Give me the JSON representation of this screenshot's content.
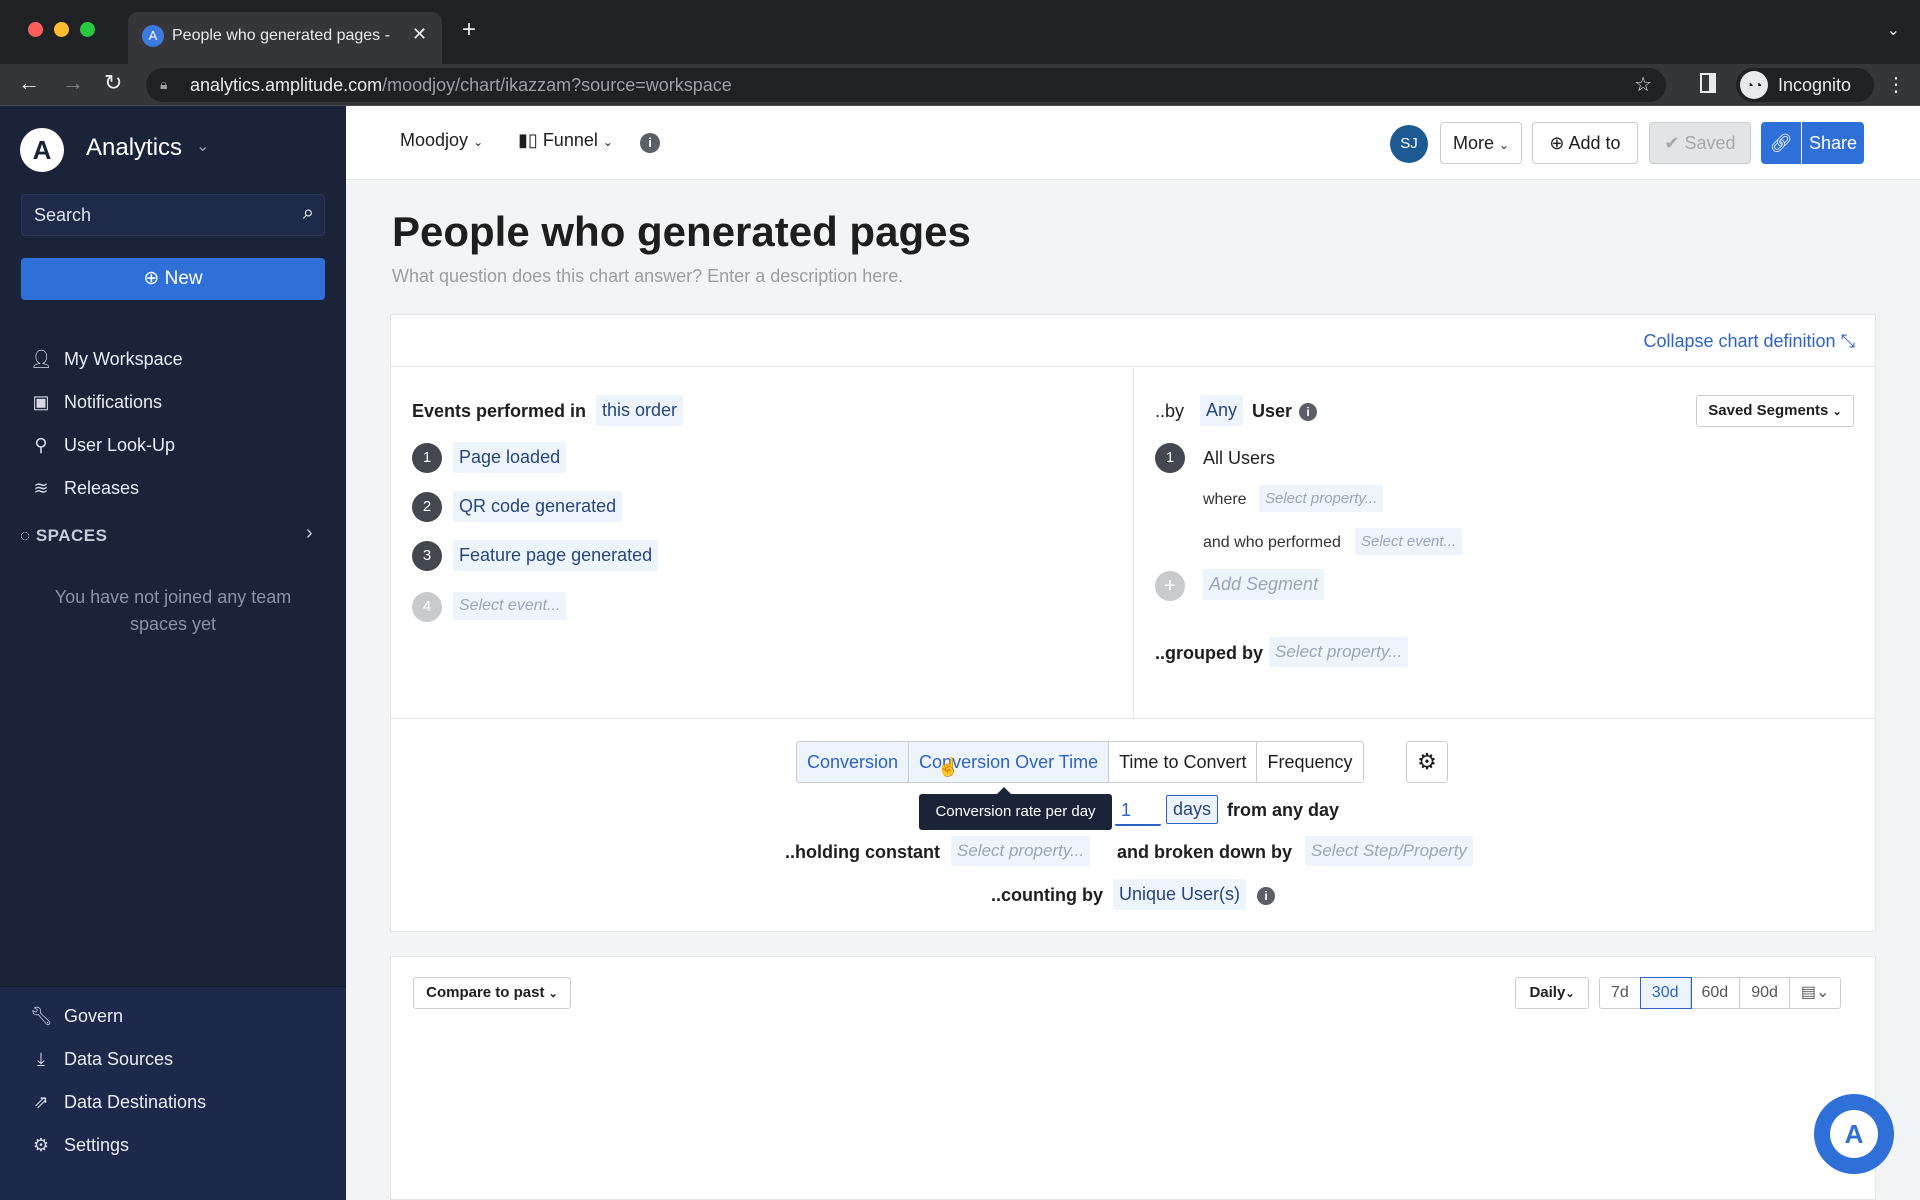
{
  "browser": {
    "tab_title": "People who generated pages -",
    "url_host": "analytics.amplitude.com",
    "url_path": "/moodjoy/chart/ikazzam?source=workspace",
    "profile_label": "Incognito"
  },
  "sidebar": {
    "app_name": "Analytics",
    "search_placeholder": "Search",
    "new_label": "New",
    "nav": [
      {
        "label": "My Workspace",
        "icon": "user-icon"
      },
      {
        "label": "Notifications",
        "icon": "inbox-icon"
      },
      {
        "label": "User Look-Up",
        "icon": "user-search-icon"
      },
      {
        "label": "Releases",
        "icon": "releases-icon"
      }
    ],
    "spaces_label": "SPACES",
    "spaces_empty": "You have not joined any team spaces yet",
    "bottom_nav": [
      {
        "label": "Govern",
        "icon": "wrench-icon"
      },
      {
        "label": "Data Sources",
        "icon": "download-icon"
      },
      {
        "label": "Data Destinations",
        "icon": "export-icon"
      },
      {
        "label": "Settings",
        "icon": "gear-icon"
      }
    ]
  },
  "topbar": {
    "project": "Moodjoy",
    "chart_type": "Funnel",
    "avatar_initials": "SJ",
    "more_label": "More",
    "add_to_label": "Add to",
    "saved_label": "Saved",
    "share_label": "Share"
  },
  "chart": {
    "title": "People who generated pages",
    "description_placeholder": "What question does this chart answer? Enter a description here.",
    "collapse_label": "Collapse chart definition",
    "events_label": "Events performed in",
    "order_label": "this order",
    "events": [
      {
        "num": "1",
        "label": "Page loaded"
      },
      {
        "num": "2",
        "label": "QR code generated"
      },
      {
        "num": "3",
        "label": "Feature page generated"
      }
    ],
    "next_event": {
      "num": "4",
      "placeholder": "Select event..."
    },
    "by_label": "..by",
    "by_any": "Any",
    "by_user": "User",
    "saved_segments": "Saved Segments",
    "segment": {
      "num": "1",
      "name": "All Users",
      "where_label": "where",
      "where_placeholder": "Select property...",
      "performed_label": "and who performed",
      "performed_placeholder": "Select event..."
    },
    "add_segment": "Add Segment",
    "grouped_label": "..grouped by",
    "grouped_placeholder": "Select property...",
    "tabs": [
      "Conversion",
      "Conversion Over Time",
      "Time to Convert",
      "Frequency"
    ],
    "selected_tab": "Conversion",
    "tooltip": "Conversion rate per day",
    "window_value": "1",
    "window_unit": "days",
    "window_suffix": "from any day",
    "holding_label": "..holding constant",
    "holding_placeholder": "Select property...",
    "broken_label": "and broken down by",
    "broken_placeholder": "Select Step/Property",
    "counting_label": "..counting by",
    "counting_value": "Unique User(s)"
  },
  "controls": {
    "compare_label": "Compare to past",
    "interval": "Daily",
    "ranges": [
      "7d",
      "30d",
      "60d",
      "90d"
    ],
    "selected_range": "30d"
  }
}
